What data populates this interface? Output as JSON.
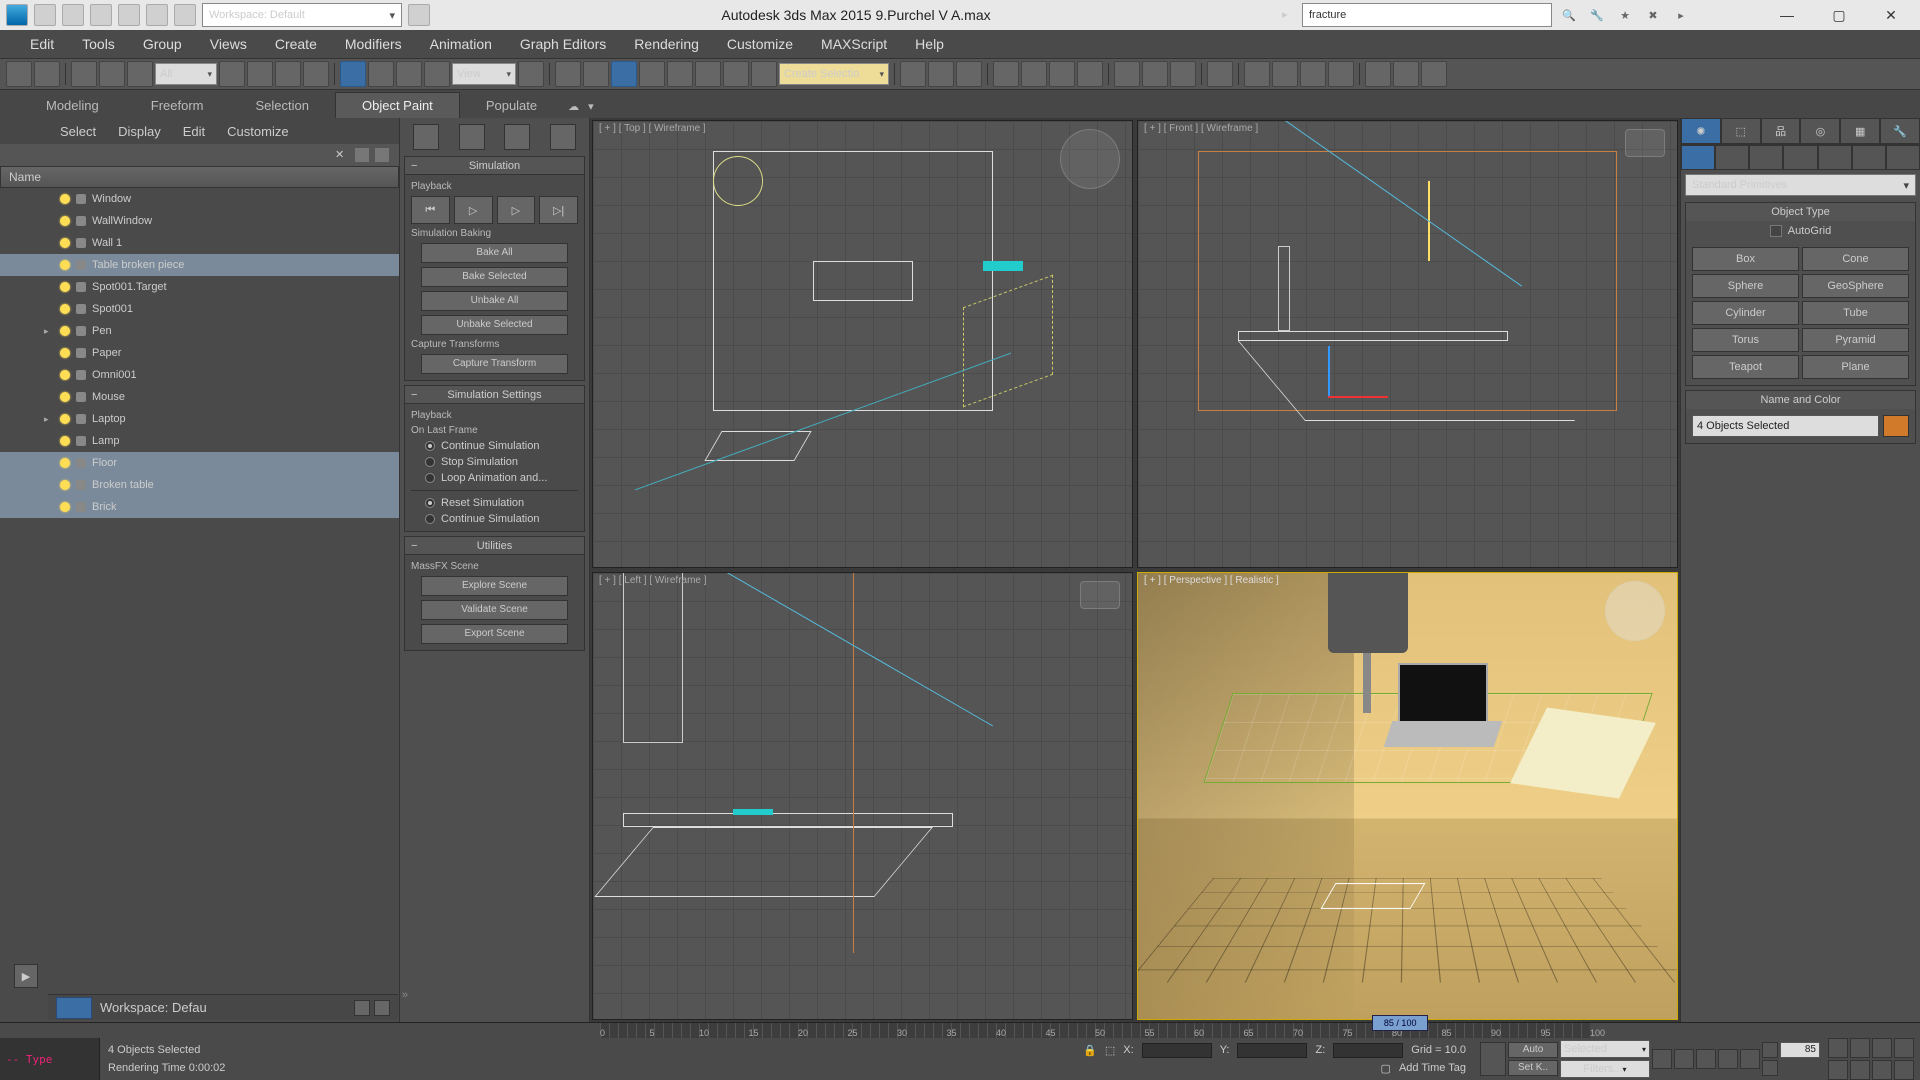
{
  "title": {
    "workspace": "Workspace: Default",
    "app": "Autodesk 3ds Max  2015     9.Purchel V A.max",
    "search": "fracture"
  },
  "menu": [
    "Edit",
    "Tools",
    "Group",
    "Views",
    "Create",
    "Modifiers",
    "Animation",
    "Graph Editors",
    "Rendering",
    "Customize",
    "MAXScript",
    "Help"
  ],
  "toolbar": {
    "filter": "All",
    "refcoord": "View",
    "named_sel": "Create Selectio"
  },
  "ribbon": {
    "tabs": [
      "Modeling",
      "Freeform",
      "Selection",
      "Object Paint",
      "Populate"
    ],
    "active": "Object Paint"
  },
  "scene_explorer": {
    "menus": [
      "Select",
      "Display",
      "Edit",
      "Customize"
    ],
    "header": "Name",
    "nodes": [
      {
        "label": "Window",
        "sel": false,
        "exp": false
      },
      {
        "label": "WallWindow",
        "sel": false,
        "exp": false
      },
      {
        "label": "Wall 1",
        "sel": false,
        "exp": false
      },
      {
        "label": "Table broken piece",
        "sel": true,
        "exp": false
      },
      {
        "label": "Spot001.Target",
        "sel": false,
        "exp": false
      },
      {
        "label": "Spot001",
        "sel": false,
        "exp": false
      },
      {
        "label": "Pen",
        "sel": false,
        "exp": true
      },
      {
        "label": "Paper",
        "sel": false,
        "exp": false
      },
      {
        "label": "Omni001",
        "sel": false,
        "exp": false
      },
      {
        "label": "Mouse",
        "sel": false,
        "exp": false
      },
      {
        "label": "Laptop",
        "sel": false,
        "exp": true
      },
      {
        "label": "Lamp",
        "sel": false,
        "exp": false
      },
      {
        "label": "Floor",
        "sel": true,
        "exp": false
      },
      {
        "label": "Broken table",
        "sel": true,
        "exp": false
      },
      {
        "label": "Brick",
        "sel": true,
        "exp": false
      }
    ],
    "workspace_label": "Workspace: Defau"
  },
  "sim": {
    "title": "Simulation",
    "playback": "Playback",
    "baking_title": "Simulation Baking",
    "bake_all": "Bake All",
    "bake_selected": "Bake Selected",
    "unbake_all": "Unbake All",
    "unbake_selected": "Unbake Selected",
    "capture_title": "Capture Transforms",
    "capture_btn": "Capture Transform",
    "settings_title": "Simulation Settings",
    "playback2": "Playback",
    "lastframe": "On Last Frame",
    "r1": "Continue Simulation",
    "r2": "Stop Simulation",
    "r3": "Loop Animation and...",
    "r4": "Reset Simulation",
    "r5": "Continue Simulation",
    "util_title": "Utilities",
    "mscene": "MassFX Scene",
    "explore": "Explore Scene",
    "validate": "Validate Scene",
    "export": "Export Scene"
  },
  "viewports": {
    "tl": "[ + ] [ Top ] [ Wireframe ]",
    "tr": "[ + ] [ Front ] [ Wireframe ]",
    "bl": "[ + ] [ Left ] [ Wireframe ]",
    "br": "[ + ] [ Perspective ] [ Realistic ]"
  },
  "cmd": {
    "category": "Standard Primitives",
    "objtype_title": "Object Type",
    "autogrid": "AutoGrid",
    "buttons": [
      "Box",
      "Cone",
      "Sphere",
      "GeoSphere",
      "Cylinder",
      "Tube",
      "Torus",
      "Pyramid",
      "Teapot",
      "Plane"
    ],
    "namec_title": "Name and Color",
    "name_value": "4 Objects Selected"
  },
  "timeline": {
    "marker": "85 / 100",
    "ticks": [
      "0",
      "5",
      "10",
      "15",
      "20",
      "25",
      "30",
      "35",
      "40",
      "45",
      "50",
      "55",
      "60",
      "65",
      "70",
      "75",
      "80",
      "85",
      "90",
      "95",
      "100"
    ]
  },
  "status": {
    "type_label": "-- Type",
    "sel": "4 Objects Selected",
    "render": "Rendering Time  0:00:02",
    "x": "X:",
    "y": "Y:",
    "z": "Z:",
    "grid": "Grid = 10.0",
    "addtag": "Add Time Tag",
    "auto": "Auto",
    "setk": "Set K..",
    "seldd": "Selected",
    "filters": "Filters...",
    "frame": "85"
  }
}
